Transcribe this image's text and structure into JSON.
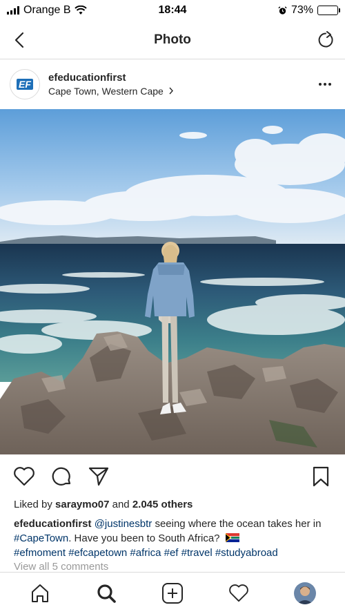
{
  "status_bar": {
    "carrier": "Orange B",
    "time": "18:44",
    "battery_percent": "73%",
    "battery_level": 0.73
  },
  "nav": {
    "title": "Photo",
    "back_icon": "chevron-left-icon",
    "refresh_icon": "refresh-icon"
  },
  "post": {
    "username": "efeducationfirst",
    "location": "Cape Town, Western Cape",
    "avatar_text": "EF",
    "likes": {
      "prefix": "Liked by",
      "user": "saraymo07",
      "middle": "and",
      "others": "2.045 others"
    },
    "caption": {
      "username": "efeducationfirst",
      "mention": "@justinesbtr",
      "text1": " seeing where the ocean takes her in ",
      "hashtag1": "#CapeTown",
      "text2": ". Have you been to South Africa?",
      "hashtags": "#efmoment #efcapetown #africa #ef #travel #studyabroad"
    },
    "comments_link": "View all 5 comments"
  },
  "colors": {
    "link": "#003569",
    "muted": "#999999",
    "border": "#dbdbdb",
    "text": "#262626"
  }
}
